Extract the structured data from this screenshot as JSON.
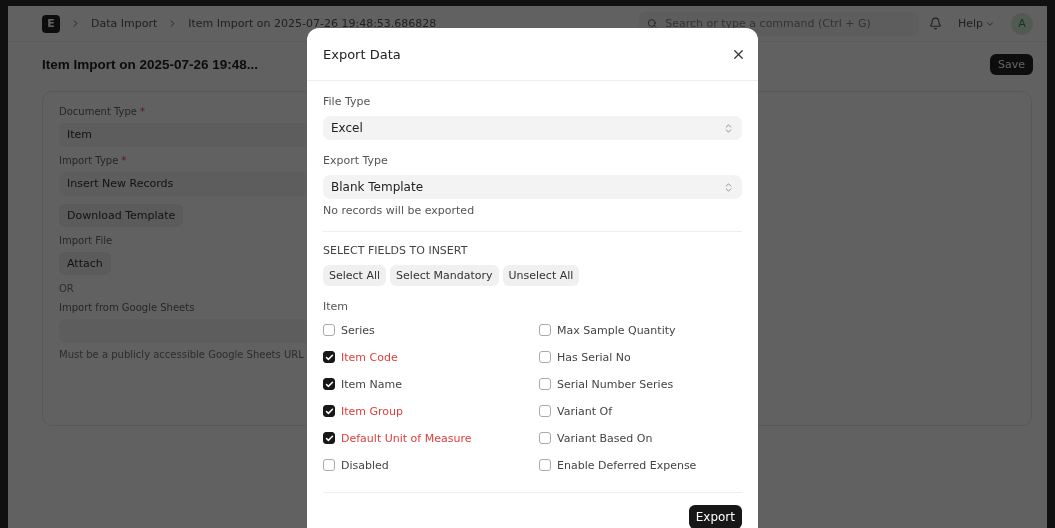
{
  "navbar": {
    "logo": "E",
    "breadcrumbs": [
      "Data Import",
      "Item Import on 2025-07-26 19:48:53.686828"
    ],
    "search": {
      "placeholder": "Search or type a command (Ctrl + G)"
    },
    "help": "Help",
    "avatar": "A"
  },
  "page": {
    "title": "Item Import on 2025-07-26 19:48...",
    "save": "Save"
  },
  "form": [
    {
      "kind": "select",
      "label": "Document Type",
      "required_mark": "*",
      "value": "Item"
    },
    {
      "kind": "select",
      "label": "Import Type",
      "required_mark": "*",
      "value": "Insert New Records"
    },
    {
      "kind": "button",
      "label": "Download Template"
    },
    {
      "kind": "attach",
      "label": "Import File",
      "button": "Attach"
    },
    {
      "kind": "text",
      "text": "OR"
    },
    {
      "kind": "input",
      "label": "Import from Google Sheets",
      "description": "Must be a publicly accessible Google Sheets URL"
    }
  ],
  "modal": {
    "title": "Export Data",
    "file_type": {
      "label": "File Type",
      "value": "Excel"
    },
    "export_type": {
      "label": "Export Type",
      "value": "Blank Template",
      "description": "No records will be exported"
    },
    "section_title": "SELECT FIELDS TO INSERT",
    "buttons": [
      "Select All",
      "Select Mandatory",
      "Unselect All"
    ],
    "group": "Item",
    "fields": [
      {
        "label": "Series",
        "checked": false,
        "required": false
      },
      {
        "label": "Item Code",
        "checked": true,
        "required": true
      },
      {
        "label": "Item Name",
        "checked": true,
        "required": false
      },
      {
        "label": "Item Group",
        "checked": true,
        "required": true
      },
      {
        "label": "Default Unit of Measure",
        "checked": true,
        "required": true
      },
      {
        "label": "Disabled",
        "checked": false,
        "required": false
      },
      {
        "label": "Max Sample Quantity",
        "checked": false,
        "required": false
      },
      {
        "label": "Has Serial No",
        "checked": false,
        "required": false
      },
      {
        "label": "Serial Number Series",
        "checked": false,
        "required": false
      },
      {
        "label": "Variant Of",
        "checked": false,
        "required": false
      },
      {
        "label": "Variant Based On",
        "checked": false,
        "required": false
      },
      {
        "label": "Enable Deferred Expense",
        "checked": false,
        "required": false
      }
    ],
    "primary": "Export"
  }
}
